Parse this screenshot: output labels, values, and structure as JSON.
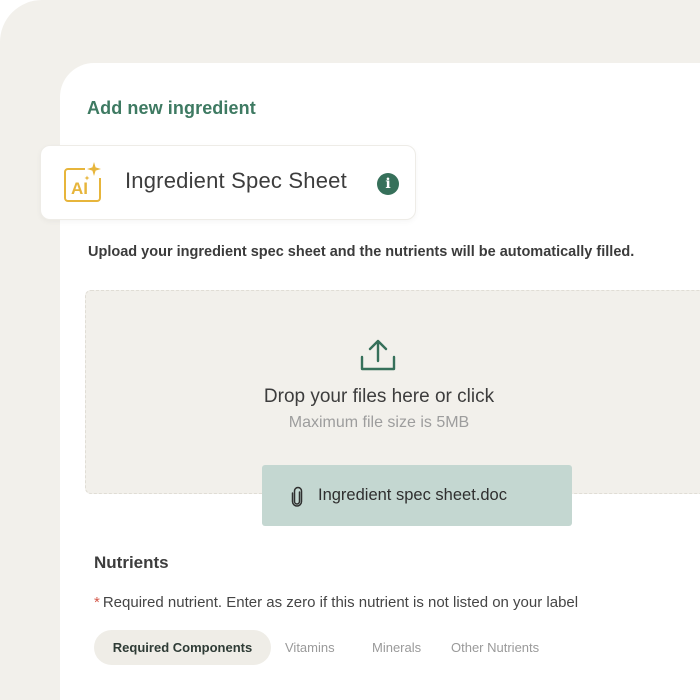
{
  "page": {
    "heading": "Add new ingredient"
  },
  "spec_card": {
    "icon": "ai-sparkle-icon",
    "ai_text": "AI",
    "title": "Ingredient Spec Sheet",
    "info_icon": "info-icon"
  },
  "upload": {
    "description": "Upload your ingredient spec sheet and the nutrients will be automatically filled.",
    "drop_title": "Drop your files here or click",
    "drop_subtitle": "Maximum file size is 5MB",
    "icon": "upload-icon"
  },
  "file": {
    "name": "Ingredient spec sheet.doc",
    "icon": "paperclip-icon"
  },
  "nutrients": {
    "title": "Nutrients",
    "required_star": "*",
    "required_note": "Required nutrient. Enter as zero if this nutrient is not listed on your label",
    "tabs": [
      {
        "label": "Required Components",
        "active": true
      },
      {
        "label": "Vitamins",
        "active": false
      },
      {
        "label": "Minerals",
        "active": false
      },
      {
        "label": "Other Nutrients",
        "active": false
      }
    ]
  },
  "colors": {
    "accent_green": "#3e7a62",
    "icon_green": "#36705a",
    "ai_gold": "#e7b53b",
    "dropzone_bg": "#f2f0eb",
    "file_chip_bg": "#c4d7d1",
    "required_red": "#d4584a"
  }
}
